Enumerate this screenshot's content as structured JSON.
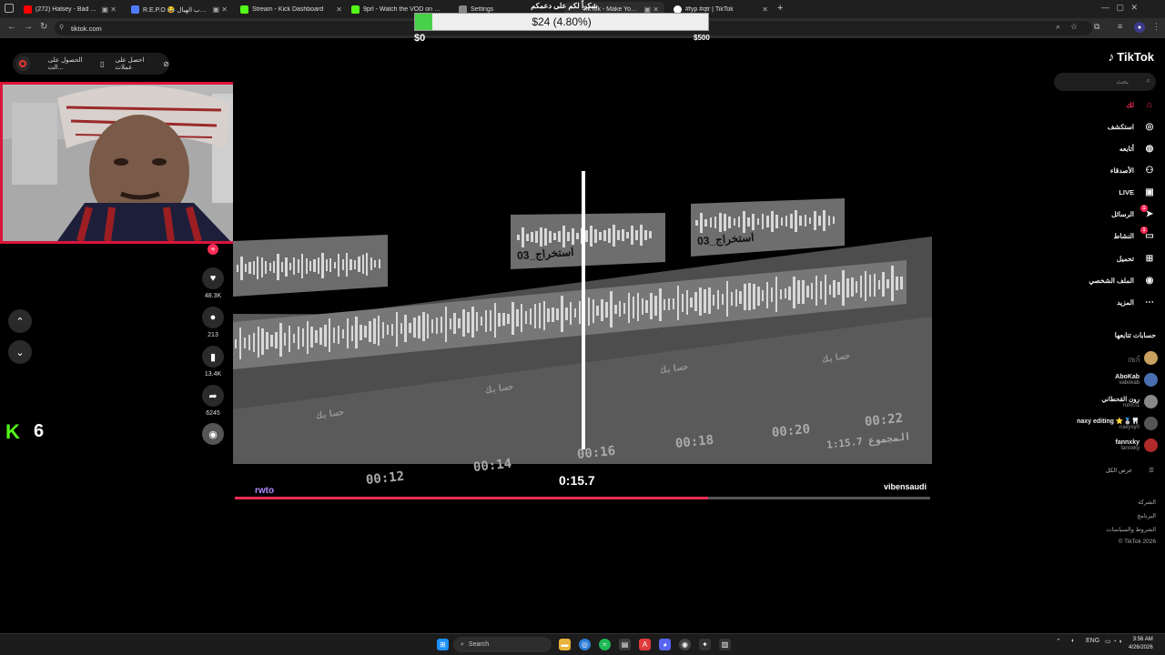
{
  "browser": {
    "tabs": [
      {
        "title": "(272) Halsey - Bad At Love",
        "favicon_color": "#ff0000"
      },
      {
        "title": "R.E.P.O 😂 جرب الهيال !! - Reddi",
        "favicon_color": "#4f7cff"
      },
      {
        "title": "Stream - Kick Dashboard",
        "favicon_color": "#53fc18"
      },
      {
        "title": "9prl - Watch the VOD on Kick",
        "favicon_color": "#53fc18"
      },
      {
        "title": "Settings",
        "favicon_color": "#888888"
      },
      {
        "title": "TikTok - Make Your Day",
        "favicon_color": "#888888"
      },
      {
        "title": "#fyp #qtr | TikTok",
        "favicon_color": "#ffffff"
      }
    ],
    "url": "tiktok.com"
  },
  "donation": {
    "title": "شكراً لكم على دعمكم",
    "amount_text": "$24 (4.80%)",
    "progress": 0.048,
    "min_label": "$0",
    "max_label": "$500",
    "fill_color": "#49d04a"
  },
  "top_pills": {
    "left_label": "الحصول على الت...",
    "right_label": "احصل على عملات"
  },
  "video": {
    "pill_label": "استخراج_03",
    "track_label": "حسابك",
    "timecodes": [
      "00:12",
      "00:14",
      "00:16",
      "00:18",
      "00:20",
      "00:22"
    ],
    "current_time": "0:15.7",
    "total": "المجموع 1:15.7",
    "author": "vibensaudi",
    "tag": "rwto",
    "progress": 0.68
  },
  "actions": {
    "likes": "48.3K",
    "comments": "213",
    "saves": "13.4K",
    "shares": "6245"
  },
  "kick": {
    "logo": "K",
    "count": "6"
  },
  "sidebar": {
    "logo": "TikTok",
    "search_placeholder": "بحث",
    "nav": [
      {
        "label": "لك",
        "icon": "home-icon",
        "active": true
      },
      {
        "label": "استكشف",
        "icon": "compass-icon"
      },
      {
        "label": "أتابعه",
        "icon": "following-icon"
      },
      {
        "label": "الأصدقاء",
        "icon": "friends-icon"
      },
      {
        "label": "LIVE",
        "icon": "live-icon"
      },
      {
        "label": "الرسائل",
        "icon": "send-icon",
        "badge": "1"
      },
      {
        "label": "النشاط",
        "icon": "inbox-icon",
        "badge": "1"
      },
      {
        "label": "تحميل",
        "icon": "upload-icon"
      },
      {
        "label": "الملف الشخصي",
        "icon": "profile-icon"
      },
      {
        "label": "المزيد",
        "icon": "more-icon"
      }
    ],
    "following_title": "حسابات تتابعها",
    "accounts": [
      {
        "name": ".",
        "user": "l7b7l"
      },
      {
        "name": "AboKab",
        "user": "vabokab"
      },
      {
        "name": "رون القحطاني",
        "user": "ronn.l1"
      },
      {
        "name": "naxy editing ⭐🥈🦷",
        "user": "naxysy0"
      },
      {
        "name": "fannxky",
        "user": "fannxky"
      }
    ],
    "see_all": "عرض الكل",
    "footer": [
      "الشركة",
      "البرنامج",
      "الشروط والسياسات",
      "© TikTok 2026"
    ]
  },
  "taskbar": {
    "search": "Search",
    "lang": "ENG",
    "time": "3:56 AM",
    "date": "4/26/2026"
  }
}
